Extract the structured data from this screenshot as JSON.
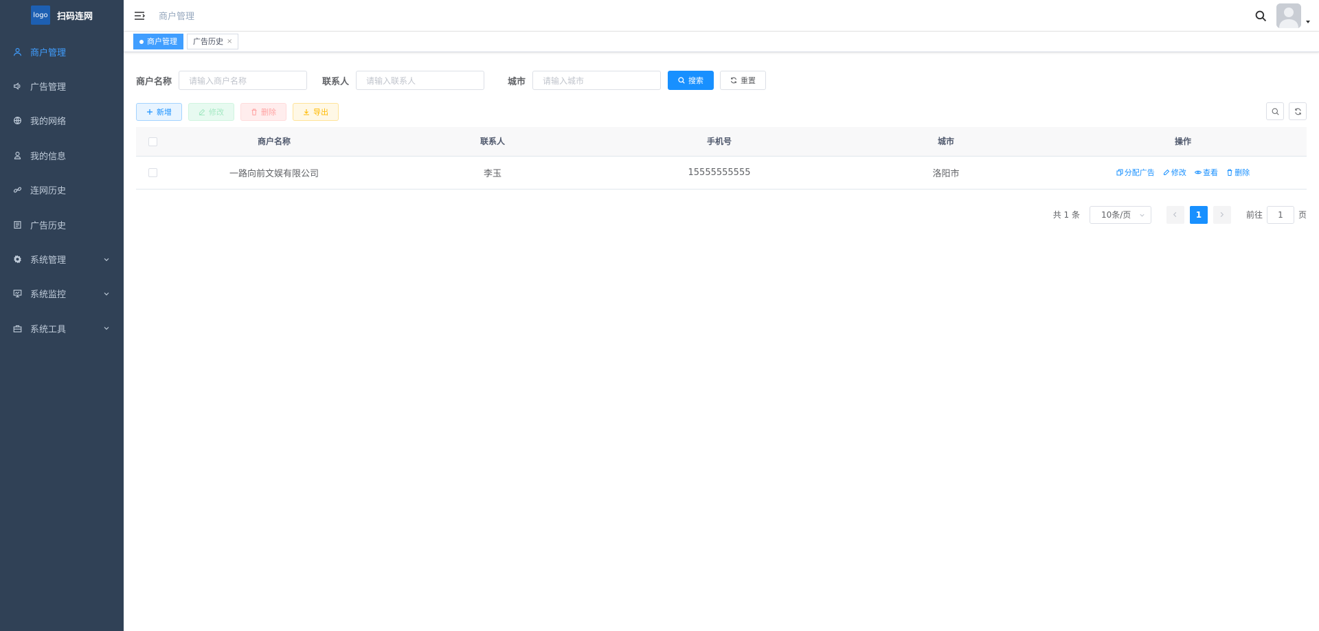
{
  "app": {
    "logo_text": "logo",
    "title": "扫码连网"
  },
  "sidebar": {
    "items": [
      {
        "label": "商户管理",
        "icon": "user-icon",
        "active": true
      },
      {
        "label": "广告管理",
        "icon": "speaker-icon"
      },
      {
        "label": "我的网络",
        "icon": "globe-icon"
      },
      {
        "label": "我的信息",
        "icon": "person-icon"
      },
      {
        "label": "连网历史",
        "icon": "link-icon"
      },
      {
        "label": "广告历史",
        "icon": "document-icon"
      },
      {
        "label": "系统管理",
        "icon": "gear-icon",
        "expandable": true
      },
      {
        "label": "系统监控",
        "icon": "monitor-icon",
        "expandable": true
      },
      {
        "label": "系统工具",
        "icon": "toolbox-icon",
        "expandable": true
      }
    ]
  },
  "navbar": {
    "breadcrumb": "商户管理"
  },
  "tags": [
    {
      "label": "商户管理",
      "active": true
    },
    {
      "label": "广告历史",
      "close": "×"
    }
  ],
  "search": {
    "merchant_label": "商户名称",
    "merchant_placeholder": "请输入商户名称",
    "contact_label": "联系人",
    "contact_placeholder": "请输入联系人",
    "city_label": "城市",
    "city_placeholder": "请输入城市",
    "search_button": "搜索",
    "reset_button": "重置"
  },
  "toolbar": {
    "add": "新增",
    "edit": "修改",
    "delete": "删除",
    "export": "导出"
  },
  "table": {
    "headers": [
      "商户名称",
      "联系人",
      "手机号",
      "城市",
      "操作"
    ],
    "rows": [
      {
        "name": "一路向前文娱有限公司",
        "contact": "李玉",
        "phone": "15555555555",
        "city": "洛阳市"
      }
    ],
    "actions": {
      "assign": "分配广告",
      "edit": "修改",
      "view": "查看",
      "delete": "删除"
    }
  },
  "pagination": {
    "total": "共 1 条",
    "page_size": "10条/页",
    "current_page": "1",
    "goto_label": "前往",
    "goto_value": "1",
    "page_suffix": "页"
  },
  "colors": {
    "sidebar_bg": "#304156",
    "primary": "#1890ff",
    "active_menu": "#409eff"
  }
}
